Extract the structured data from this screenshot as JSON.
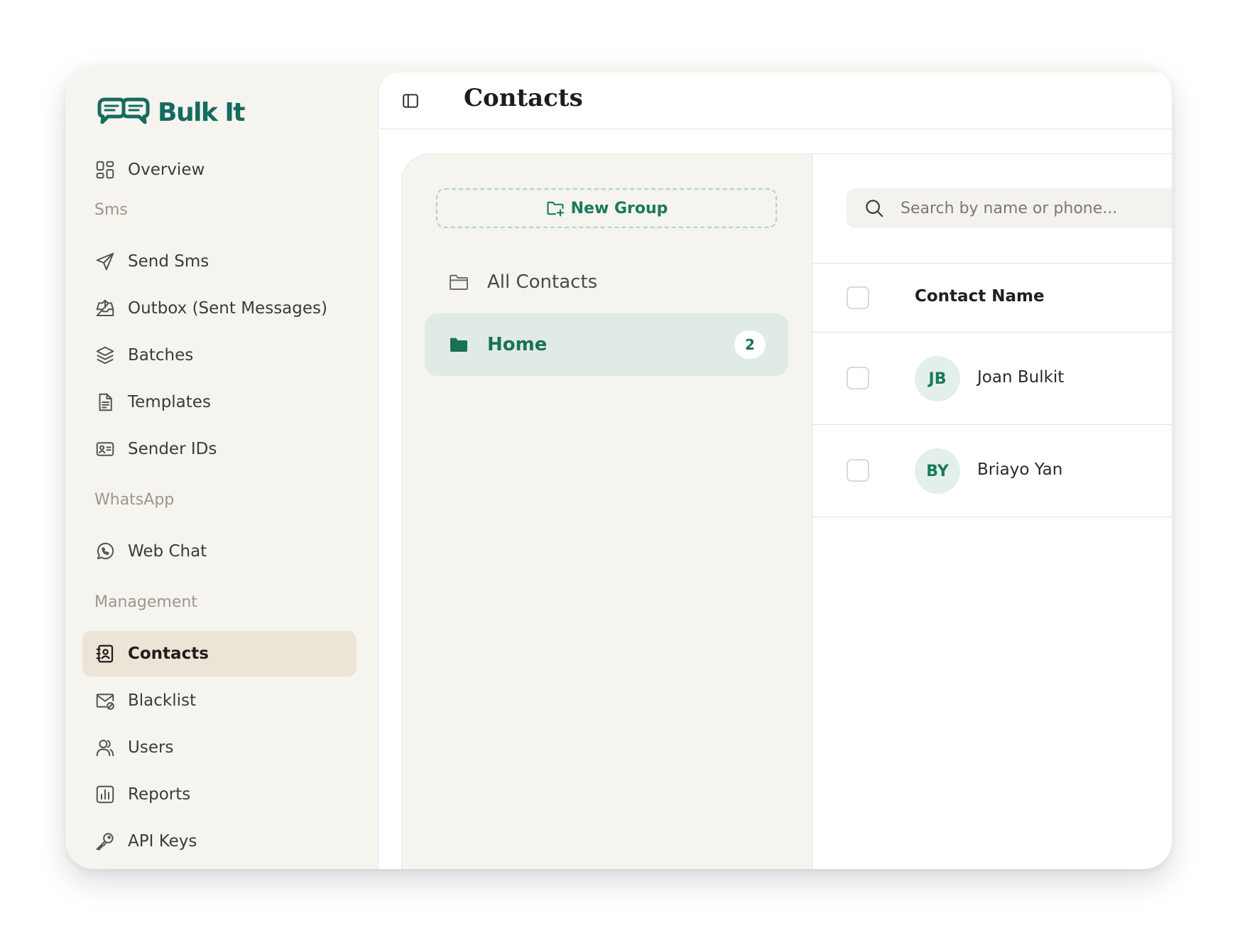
{
  "brand": {
    "name": "Bulk It"
  },
  "sidebar": {
    "overview": "Overview",
    "sections": {
      "sms": "Sms",
      "whatsapp": "WhatsApp",
      "management": "Management"
    },
    "items": {
      "send_sms": "Send Sms",
      "outbox": "Outbox (Sent Messages)",
      "batches": "Batches",
      "templates": "Templates",
      "sender_ids": "Sender IDs",
      "web_chat": "Web Chat",
      "contacts": "Contacts",
      "blacklist": "Blacklist",
      "users": "Users",
      "reports": "Reports",
      "api_keys": "API Keys"
    },
    "active": "contacts"
  },
  "header": {
    "title": "Contacts"
  },
  "groups": {
    "new_group_label": "New Group",
    "items": [
      {
        "label": "All Contacts",
        "count": null,
        "active": false
      },
      {
        "label": "Home",
        "count": "2",
        "active": true
      }
    ]
  },
  "search": {
    "placeholder": "Search by name or phone..."
  },
  "table": {
    "columns": {
      "name": "Contact Name"
    },
    "rows": [
      {
        "initials": "JB",
        "name": "Joan Bulkit"
      },
      {
        "initials": "BY",
        "name": "Briayo Yan"
      }
    ]
  },
  "colors": {
    "brand": "#156b60",
    "accent": "#197353",
    "sidebar_bg": "#f5f4ef",
    "active_nav": "#ebe4d7",
    "active_group": "#dfebe4"
  }
}
